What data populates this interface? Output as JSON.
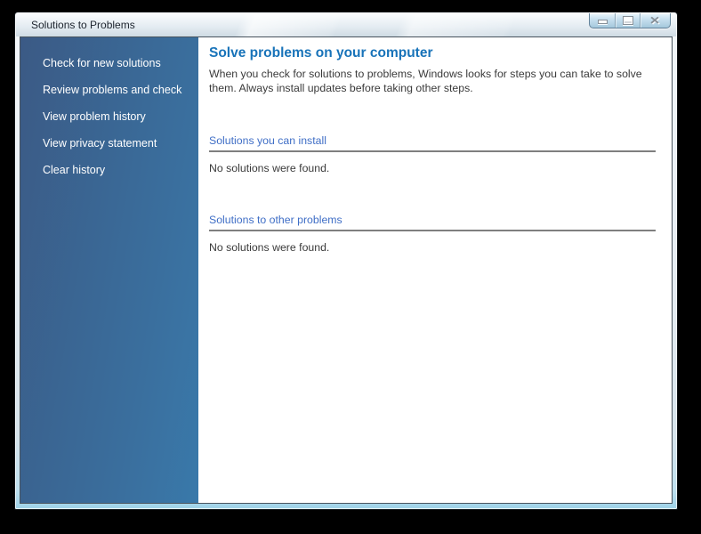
{
  "window": {
    "title": "Solutions to Problems",
    "controls": [
      {
        "name": "minimize",
        "icon": "minimize-icon"
      },
      {
        "name": "maximize",
        "icon": "maximize-icon"
      },
      {
        "name": "close",
        "icon": "close-icon",
        "glyph": "✕"
      }
    ]
  },
  "sidebar": {
    "items": [
      {
        "label": "Check for new solutions"
      },
      {
        "label": "Review problems and check"
      },
      {
        "label": "View problem history"
      },
      {
        "label": "View privacy statement"
      },
      {
        "label": "Clear history"
      }
    ]
  },
  "main": {
    "heading": "Solve problems on your computer",
    "description": "When you check for solutions to problems, Windows looks for steps you can take to solve them. Always install updates before taking other steps.",
    "sections": [
      {
        "header": "Solutions you can install",
        "message": "No solutions were found."
      },
      {
        "header": "Solutions to other problems",
        "message": "No solutions were found."
      }
    ]
  },
  "colors": {
    "sidebar_gradient_start": "#3b5a85",
    "sidebar_gradient_end": "#3979aa",
    "heading_text": "#1873b9",
    "section_header_text": "#3f6ec6",
    "body_text": "#3a3a3a",
    "titlebar_text": "#1d242e",
    "background": "#000000"
  }
}
